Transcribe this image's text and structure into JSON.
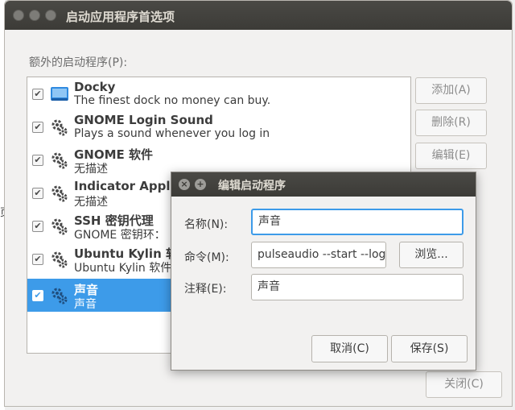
{
  "main_window": {
    "title": "启动应用程序首选项",
    "programs_label": "额外的启动程序(P):",
    "programs": [
      {
        "name": "Docky",
        "desc": "The finest dock no money can buy.",
        "checked": true,
        "icon": "docky-icon",
        "selected": false
      },
      {
        "name": "GNOME Login Sound",
        "desc": "Plays a sound whenever you log in",
        "checked": true,
        "icon": "gear-icon",
        "selected": false
      },
      {
        "name": "GNOME 软件",
        "desc": "无描述",
        "checked": true,
        "icon": "gear-icon",
        "selected": false
      },
      {
        "name": "Indicator Applic",
        "desc": "无描述",
        "checked": true,
        "icon": "gear-icon",
        "selected": false
      },
      {
        "name": "SSH 密钥代理",
        "desc": "GNOME 密钥环：",
        "checked": true,
        "icon": "gear-icon",
        "selected": false
      },
      {
        "name": "Ubuntu Kylin 软件",
        "desc": "Ubuntu Kylin 软件",
        "checked": true,
        "icon": "gear-icon",
        "selected": false
      },
      {
        "name": "声音",
        "desc": "声音",
        "checked": true,
        "icon": "gear-icon",
        "selected": true
      }
    ],
    "buttons": {
      "add": "添加(A)",
      "remove": "删除(R)",
      "edit": "编辑(E)",
      "close": "关闭(C)"
    }
  },
  "edit_dialog": {
    "title": "编辑启动程序",
    "name_label": "名称(N):",
    "name_value": "声音",
    "command_label": "命令(M):",
    "command_value": "pulseaudio --start --log",
    "browse_label": "浏览...",
    "comment_label": "注释(E):",
    "comment_value": "声音",
    "cancel_label": "取消(C)",
    "save_label": "保存(S)"
  },
  "background": {
    "edge_text": "页"
  },
  "colors": {
    "selection": "#3d9be9",
    "titlebar": "#3c3b37",
    "focus": "#3d9be9"
  }
}
